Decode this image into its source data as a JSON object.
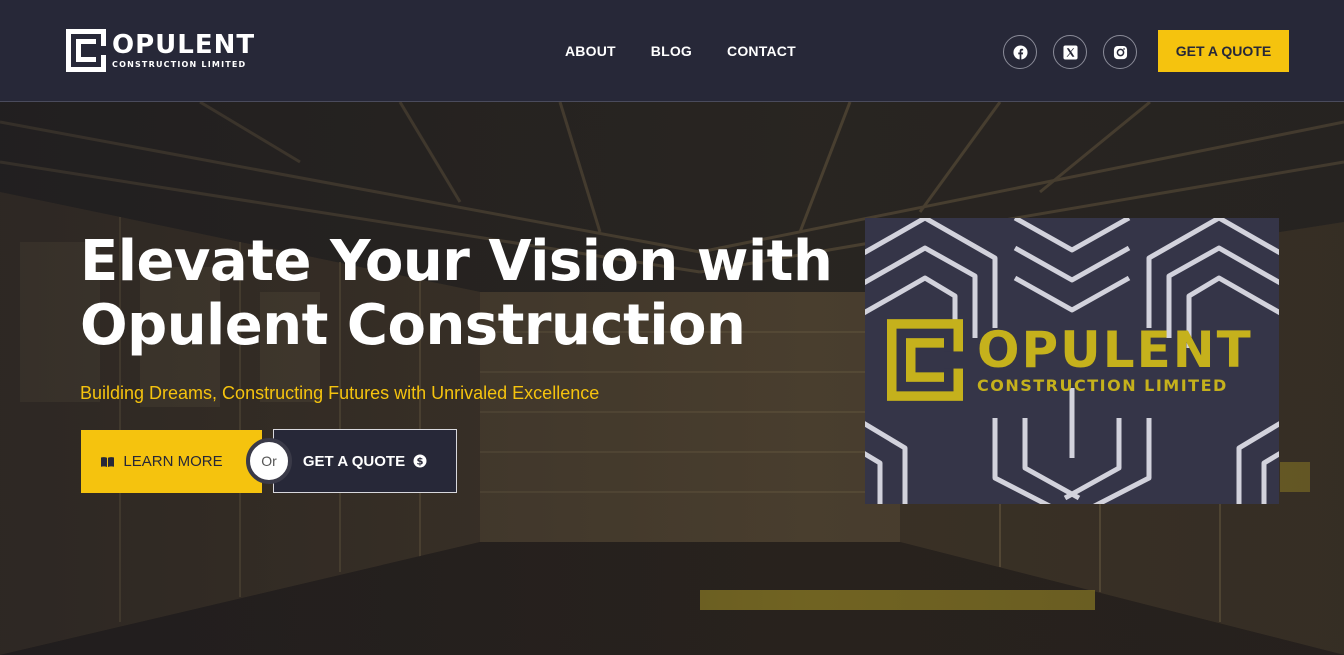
{
  "brand": {
    "name": "OPULENT",
    "tagline": "CONSTRUCTION LIMITED"
  },
  "nav": {
    "items": [
      {
        "label": "ABOUT"
      },
      {
        "label": "BLOG"
      },
      {
        "label": "CONTACT"
      }
    ]
  },
  "social": {
    "icons": [
      "facebook-icon",
      "x-twitter-icon",
      "instagram-icon"
    ]
  },
  "header": {
    "quote_label": "GET A QUOTE"
  },
  "hero": {
    "title": "Elevate Your Vision with Opulent Construction",
    "subtitle": "Building Dreams, Constructing Futures with Unrivaled Excellence",
    "learn_more_label": "LEARN MORE",
    "or_label": "Or",
    "quote_label": "GET A QUOTE"
  },
  "promo": {
    "name": "OPULENT",
    "tagline": "CONSTRUCTION LIMITED"
  },
  "colors": {
    "accent": "#f5c30e",
    "header_bg": "#272838",
    "promo_bg": "#353548",
    "promo_logo": "#c5b11c"
  }
}
